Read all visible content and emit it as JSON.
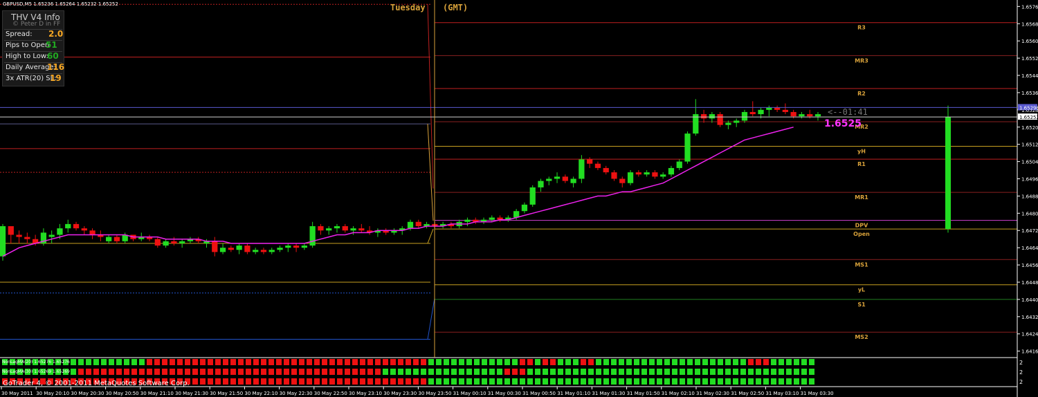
{
  "symbol_header": "GBPUSD,M5  1.65236 1.65264 1.65232 1.65252",
  "info_panel": {
    "title": "THV  V4  Info",
    "subtitle": "© Peter D in FF",
    "rows": [
      {
        "label": "Spread:",
        "value": "2.0",
        "color": "#f5a623"
      },
      {
        "label": "Pips to Open",
        "value": "51",
        "color": "#22aa22"
      },
      {
        "label": "High to Low:",
        "value": "60",
        "color": "#22aa22"
      },
      {
        "label": "Daily Average:",
        "value": "116",
        "color": "#f5a623"
      },
      {
        "label": "3x ATR(20) SL:",
        "value": "19",
        "color": "#f5a623"
      }
    ]
  },
  "session_label": "Tuesday",
  "tz_label": "(GMT)",
  "countdown": "<--01:41",
  "bid_price_big": "1.6525",
  "price_axis": {
    "ticks": [
      "1.65765",
      "1.65685",
      "1.65605",
      "1.65525",
      "1.65445",
      "1.65365",
      "1.65285",
      "1.65205",
      "1.65125",
      "1.65045",
      "1.64965",
      "1.64885",
      "1.64805",
      "1.64725",
      "1.64645",
      "1.64565",
      "1.64485",
      "1.64405",
      "1.64325",
      "1.64245",
      "1.64165"
    ],
    "bid_label": "1.65252",
    "ask_label": "1.65296"
  },
  "levels": [
    {
      "label": "R3",
      "price": 1.6569,
      "color": "#c02020"
    },
    {
      "label": "MR3",
      "price": 1.65537,
      "color": "#8a2020"
    },
    {
      "label": "R2",
      "price": 1.65384,
      "color": "#c02020"
    },
    {
      "label": "MR2",
      "price": 1.6523,
      "color": "#8a2020"
    },
    {
      "label": "yH",
      "price": 1.65116,
      "color": "#c8a020"
    },
    {
      "label": "R1",
      "price": 1.65056,
      "color": "#c02020"
    },
    {
      "label": "MR1",
      "price": 1.64902,
      "color": "#8a2020"
    },
    {
      "label": "DPV",
      "price": 1.64772,
      "color": "#d040d0"
    },
    {
      "label": "Open",
      "price": 1.64732,
      "color": "#c8a020"
    },
    {
      "label": "MS1",
      "price": 1.6459,
      "color": "#8a2020"
    },
    {
      "label": "yL",
      "price": 1.64473,
      "color": "#c8a020"
    },
    {
      "label": "S1",
      "price": 1.64405,
      "color": "#208020"
    },
    {
      "label": "MS2",
      "price": 1.64253,
      "color": "#8a2020"
    }
  ],
  "indicator_rows": [
    "NonLagMA(20) 1.65276 1.65276",
    "NonLagMA(30) 1.65269 1.65269",
    "NonLagMA(60) 1.65231 1.65231"
  ],
  "copyright": "GoTrader 4, © 2001-2011 MetaQuotes Software Corp.",
  "time_axis": [
    "30 May 2011",
    "30 May 20:10",
    "30 May 20:30",
    "30 May 20:50",
    "30 May 21:10",
    "30 May 21:30",
    "30 May 21:50",
    "30 May 22:10",
    "30 May 22:30",
    "30 May 22:50",
    "30 May 23:10",
    "30 May 23:30",
    "30 May 23:50",
    "31 May 00:10",
    "31 May 00:30",
    "31 May 00:50",
    "31 May 01:10",
    "31 May 01:30",
    "31 May 01:50",
    "31 May 02:10",
    "31 May 02:30",
    "31 May 02:50",
    "31 May 03:10",
    "31 May 03:30"
  ],
  "colors": {
    "bull": "#22dd22",
    "bear": "#ee1111",
    "ma": "#ee22ee",
    "grid_text": "#ffffff"
  },
  "chart_data": {
    "type": "candlestick",
    "y_range": [
      1.64135,
      1.65795
    ],
    "candles": [
      [
        1.64605,
        1.64755,
        1.64585,
        1.64745
      ],
      [
        1.64745,
        1.64745,
        1.64665,
        1.64705
      ],
      [
        1.64705,
        1.64725,
        1.64665,
        1.64695
      ],
      [
        1.64695,
        1.64715,
        1.64665,
        1.64685
      ],
      [
        1.64685,
        1.64705,
        1.64655,
        1.64665
      ],
      [
        1.64665,
        1.64735,
        1.64655,
        1.64715
      ],
      [
        1.64695,
        1.64725,
        1.64665,
        1.64705
      ],
      [
        1.64705,
        1.64755,
        1.64685,
        1.64735
      ],
      [
        1.64735,
        1.64775,
        1.64715,
        1.64755
      ],
      [
        1.64755,
        1.64765,
        1.64725,
        1.64735
      ],
      [
        1.64735,
        1.64745,
        1.64705,
        1.64725
      ],
      [
        1.64725,
        1.64735,
        1.64685,
        1.64705
      ],
      [
        1.64705,
        1.64725,
        1.64675,
        1.64695
      ],
      [
        1.64675,
        1.64705,
        1.64665,
        1.64695
      ],
      [
        1.64695,
        1.64705,
        1.64665,
        1.64675
      ],
      [
        1.64675,
        1.64715,
        1.64665,
        1.64705
      ],
      [
        1.64705,
        1.64705,
        1.64675,
        1.64685
      ],
      [
        1.64685,
        1.64715,
        1.64675,
        1.64695
      ],
      [
        1.64695,
        1.64705,
        1.64675,
        1.64685
      ],
      [
        1.64685,
        1.64695,
        1.64645,
        1.64655
      ],
      [
        1.64655,
        1.64685,
        1.64645,
        1.64675
      ],
      [
        1.64675,
        1.64695,
        1.64655,
        1.64665
      ],
      [
        1.64665,
        1.64685,
        1.64645,
        1.64675
      ],
      [
        1.64675,
        1.64695,
        1.64665,
        1.64685
      ],
      [
        1.64685,
        1.64695,
        1.64665,
        1.64675
      ],
      [
        1.64665,
        1.64685,
        1.64645,
        1.64675
      ],
      [
        1.64675,
        1.64695,
        1.64605,
        1.64625
      ],
      [
        1.64625,
        1.64665,
        1.64615,
        1.64645
      ],
      [
        1.64645,
        1.64655,
        1.64625,
        1.64635
      ],
      [
        1.64635,
        1.64665,
        1.64615,
        1.64655
      ],
      [
        1.64655,
        1.64665,
        1.64615,
        1.64625
      ],
      [
        1.64625,
        1.64645,
        1.64615,
        1.64635
      ],
      [
        1.64635,
        1.64645,
        1.64615,
        1.64625
      ],
      [
        1.64625,
        1.64645,
        1.64615,
        1.64635
      ],
      [
        1.64635,
        1.64655,
        1.64625,
        1.64645
      ],
      [
        1.64645,
        1.64665,
        1.64625,
        1.64655
      ],
      [
        1.64655,
        1.64665,
        1.64625,
        1.64645
      ],
      [
        1.64645,
        1.64665,
        1.64635,
        1.64655
      ],
      [
        1.64655,
        1.64765,
        1.64645,
        1.64745
      ],
      [
        1.64745,
        1.64755,
        1.64705,
        1.64725
      ],
      [
        1.64725,
        1.64745,
        1.64705,
        1.64735
      ],
      [
        1.64735,
        1.64755,
        1.64715,
        1.64745
      ],
      [
        1.64745,
        1.64755,
        1.64715,
        1.64725
      ],
      [
        1.64725,
        1.64745,
        1.64705,
        1.64735
      ],
      [
        1.64735,
        1.64755,
        1.64715,
        1.64725
      ],
      [
        1.64725,
        1.64745,
        1.64705,
        1.64715
      ],
      [
        1.64715,
        1.64735,
        1.64695,
        1.64725
      ],
      [
        1.64725,
        1.64735,
        1.64705,
        1.64715
      ],
      [
        1.64715,
        1.64735,
        1.64705,
        1.64725
      ],
      [
        1.64725,
        1.64745,
        1.64705,
        1.64735
      ],
      [
        1.64735,
        1.64775,
        1.64725,
        1.64765
      ],
      [
        1.64765,
        1.64775,
        1.64735,
        1.64745
      ],
      [
        1.64745,
        1.64765,
        1.64735,
        1.64755
      ],
      [
        1.64755,
        1.64765,
        1.64735,
        1.64745
      ],
      [
        1.64745,
        1.64765,
        1.64735,
        1.64755
      ],
      [
        1.64755,
        1.64765,
        1.64735,
        1.64745
      ],
      [
        1.64745,
        1.64775,
        1.64735,
        1.64765
      ],
      [
        1.64765,
        1.64785,
        1.64745,
        1.64775
      ],
      [
        1.64775,
        1.64785,
        1.64755,
        1.64765
      ],
      [
        1.64765,
        1.64785,
        1.64755,
        1.64775
      ],
      [
        1.64775,
        1.64795,
        1.64765,
        1.64785
      ],
      [
        1.64785,
        1.64795,
        1.64765,
        1.64775
      ],
      [
        1.64775,
        1.64795,
        1.64765,
        1.64785
      ],
      [
        1.64785,
        1.64825,
        1.64775,
        1.64815
      ],
      [
        1.64815,
        1.64855,
        1.64805,
        1.64845
      ],
      [
        1.64845,
        1.64935,
        1.64835,
        1.64925
      ],
      [
        1.64925,
        1.64965,
        1.64905,
        1.64955
      ],
      [
        1.64955,
        1.64975,
        1.64935,
        1.64965
      ],
      [
        1.64965,
        1.64995,
        1.64945,
        1.64975
      ],
      [
        1.64975,
        1.64985,
        1.64945,
        1.64955
      ],
      [
        1.64945,
        1.64975,
        1.64925,
        1.64965
      ],
      [
        1.64965,
        1.65075,
        1.64945,
        1.65055
      ],
      [
        1.65055,
        1.65065,
        1.65015,
        1.65035
      ],
      [
        1.65035,
        1.65045,
        1.65005,
        1.65015
      ],
      [
        1.65015,
        1.65025,
        1.64985,
        1.64995
      ],
      [
        1.64995,
        1.65005,
        1.64955,
        1.64965
      ],
      [
        1.64965,
        1.64975,
        1.64925,
        1.64945
      ],
      [
        1.64945,
        1.65005,
        1.64935,
        1.64995
      ],
      [
        1.64995,
        1.65005,
        1.64975,
        1.64985
      ],
      [
        1.64985,
        1.65005,
        1.64975,
        1.64995
      ],
      [
        1.64995,
        1.65005,
        1.64965,
        1.64975
      ],
      [
        1.64975,
        1.64995,
        1.64965,
        1.64985
      ],
      [
        1.64985,
        1.65025,
        1.64975,
        1.65015
      ],
      [
        1.65015,
        1.65055,
        1.65005,
        1.65045
      ],
      [
        1.65045,
        1.65185,
        1.65035,
        1.65175
      ],
      [
        1.65175,
        1.65335,
        1.65165,
        1.65265
      ],
      [
        1.65265,
        1.65285,
        1.65225,
        1.65245
      ],
      [
        1.65245,
        1.65275,
        1.65225,
        1.65265
      ],
      [
        1.65265,
        1.65275,
        1.65205,
        1.65215
      ],
      [
        1.65215,
        1.65235,
        1.65195,
        1.65225
      ],
      [
        1.65225,
        1.65245,
        1.65205,
        1.65235
      ],
      [
        1.65235,
        1.65285,
        1.65225,
        1.65275
      ],
      [
        1.65275,
        1.65325,
        1.65255,
        1.65265
      ],
      [
        1.65265,
        1.65295,
        1.65245,
        1.65285
      ],
      [
        1.65285,
        1.65305,
        1.65255,
        1.65295
      ],
      [
        1.65295,
        1.65305,
        1.65275,
        1.65285
      ],
      [
        1.65285,
        1.65315,
        1.65265,
        1.65275
      ],
      [
        1.65275,
        1.65285,
        1.65245,
        1.65255
      ],
      [
        1.65255,
        1.65275,
        1.65245,
        1.65265
      ],
      [
        1.65265,
        1.65285,
        1.65245,
        1.65255
      ],
      [
        1.65255,
        1.65275,
        1.65235,
        1.65265
      ]
    ],
    "moving_average": [
      1.64605,
      1.64625,
      1.64645,
      1.64655,
      1.64665,
      1.64675,
      1.64685,
      1.64695,
      1.64705,
      1.64705,
      1.64705,
      1.64705,
      1.64705,
      1.64705,
      1.64705,
      1.64705,
      1.64695,
      1.64695,
      1.64695,
      1.64695,
      1.64685,
      1.64685,
      1.64685,
      1.64685,
      1.64685,
      1.64675,
      1.64675,
      1.64675,
      1.64665,
      1.64665,
      1.64665,
      1.64665,
      1.64665,
      1.64665,
      1.64665,
      1.64665,
      1.64665,
      1.64665,
      1.64675,
      1.64685,
      1.64695,
      1.64705,
      1.64705,
      1.64715,
      1.64715,
      1.64715,
      1.64725,
      1.64725,
      1.64725,
      1.64725,
      1.64735,
      1.64735,
      1.64745,
      1.64745,
      1.64745,
      1.64755,
      1.64755,
      1.64755,
      1.64765,
      1.64765,
      1.64765,
      1.64775,
      1.64775,
      1.64785,
      1.64795,
      1.64805,
      1.64815,
      1.64825,
      1.64835,
      1.64845,
      1.64855,
      1.64865,
      1.64875,
      1.64885,
      1.64885,
      1.64895,
      1.64905,
      1.64905,
      1.64915,
      1.64925,
      1.64935,
      1.64945,
      1.64965,
      1.64985,
      1.65005,
      1.65025,
      1.65045,
      1.65065,
      1.65085,
      1.65105,
      1.65125,
      1.65145,
      1.65155,
      1.65165,
      1.65175,
      1.65185,
      1.65195,
      1.65205
    ],
    "signal_rows": [
      "GGGGGGGGGGGGGGGGGGGRRRRRRRRRRRRRRRRRRRRRRRRRRRRRRRRRRRRRGGGGGGGGGGGGRRGRRGGGRRGGGGGGGGGGGGGGGGGGGGRRRGGGGGGRRRGRRRRGGGGGGGGGGGGGGGGGGGRRGR",
      "GGGGGGGGGGRRRRRRRRRRRRRRRRRRRRRRRRRRRRRRRRRRRRRRRRGGGGGGGGGGGGGGGGRRRGGGGGGGGGGGGGGGGGGGGGGGGGGGGGGGGGGGGGGGGGGGGGGGGGGGGGGGGGGGGGGGGGGGGGGGG",
      "RRRRRRRRRRRRRRRRRRRRRRRRRRRRRRRRRRRRRRRRRRRRRRRRRRRRRRRRGGGGGGGGGGGGGGGGGGGGGGGGGGGGGGGGGGGGGGGGGGGGGGGGGGGGGGGGGGGGGGGGGGGGGGGGGGGGGGGGGGGG"
    ],
    "daily_bar": {
      "open": 1.64732,
      "high": 1.65305,
      "low": 1.64715,
      "close": 1.65252
    }
  }
}
